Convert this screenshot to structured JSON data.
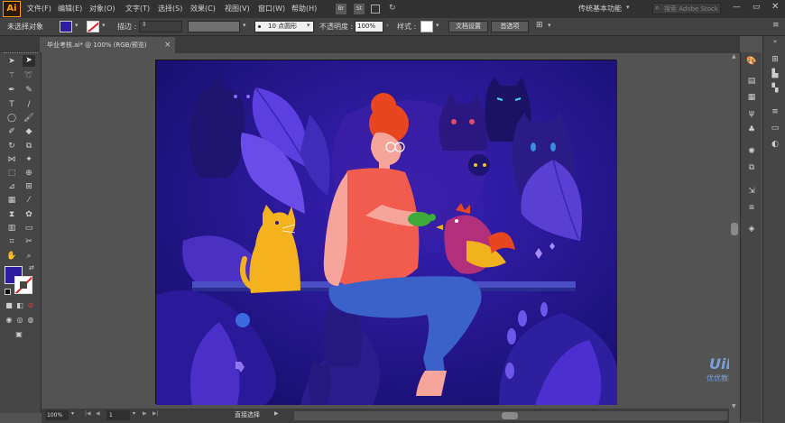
{
  "app": {
    "logo": "Ai"
  },
  "menu": {
    "items": [
      "文件(F)",
      "编辑(E)",
      "对象(O)",
      "文字(T)",
      "选择(S)",
      "效果(C)",
      "视图(V)",
      "窗口(W)",
      "帮助(H)"
    ],
    "badges": [
      "Br",
      "St"
    ],
    "workspace": "传统基本功能",
    "search_placeholder": "搜索 Adobe Stock"
  },
  "control": {
    "selection_label": "未选择对象",
    "stroke_label": "描边 :",
    "brush_value": "10 点圆形",
    "opacity_label": "不透明度 :",
    "opacity_value": "100%",
    "style_label": "样式 :",
    "doc_setup": "文档设置",
    "preferences": "首选项"
  },
  "tab": {
    "title": "毕业考核.ai* @ 100% (RGB/预览)",
    "close": "×"
  },
  "status": {
    "zoom": "100%",
    "page": "1",
    "tool": "直接选择"
  },
  "watermark": {
    "line1": "UiB",
    "line2": "优优教程网"
  },
  "colors": {
    "fill": "#2f1fa0",
    "canvas_bg": "#1c1478",
    "hair": "#e8461e",
    "shirt": "#f25c4e",
    "jeans": "#3a62c9",
    "cat": "#f5b21f",
    "bird": "#b2307b"
  }
}
